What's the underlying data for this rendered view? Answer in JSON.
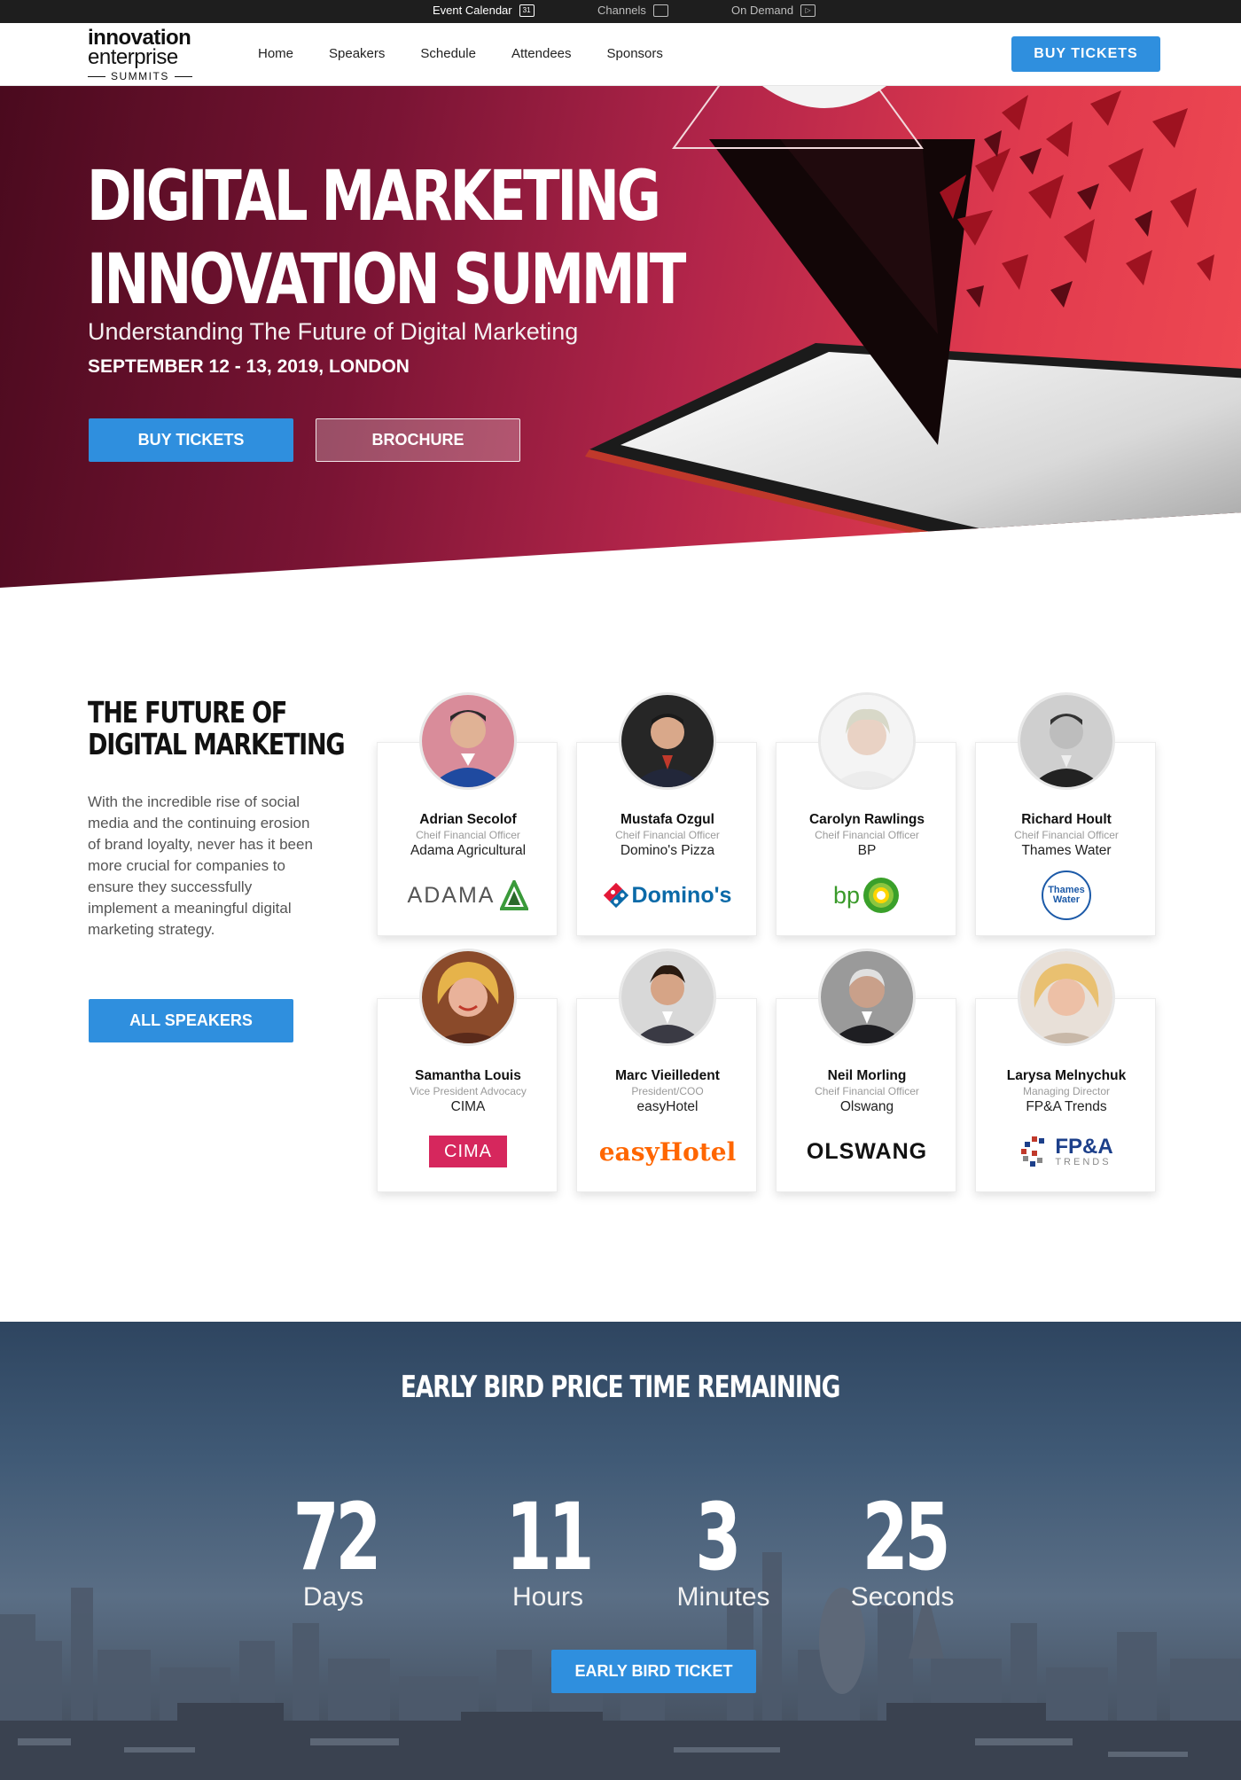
{
  "topbar": {
    "items": [
      {
        "label": "Event Calendar",
        "icon": "calendar-icon",
        "icon_text": "31"
      },
      {
        "label": "Channels",
        "icon": "monitor-icon"
      },
      {
        "label": "On Demand",
        "icon": "play-icon"
      }
    ]
  },
  "logo": {
    "line1": "innovation",
    "line2": "enterprise",
    "line3": "SUMMITS"
  },
  "nav": {
    "items": [
      "Home",
      "Speakers",
      "Schedule",
      "Attendees",
      "Sponsors"
    ],
    "buy_label": "BUY  TICKETS"
  },
  "hero": {
    "title_line1": "DIGITAL MARKETING",
    "title_line2": "INNOVATION SUMMIT",
    "subtitle": "Understanding The Future of Digital Marketing",
    "date": "SEPTEMBER 12 - 13, 2019, LONDON",
    "buy_label": "BUY TICKETS",
    "brochure_label": "BROCHURE"
  },
  "speakers_section": {
    "title_line1": "THE FUTURE OF",
    "title_line2": "DIGITAL MARKETING",
    "description": "With the incredible rise of social media and the continuing erosion of brand loyalty, never has it been more crucial for companies to ensure they successfully implement a meaningful digital marketing strategy.",
    "all_label": "ALL SPEAKERS",
    "speakers": [
      {
        "name": "Adrian Secolof",
        "role": "Cheif Financial Officer",
        "company": "Adama Agricultural",
        "logo_text": "ADAMA"
      },
      {
        "name": "Mustafa Ozgul",
        "role": "Cheif Financial Officer",
        "company": "Domino's Pizza",
        "logo_text": "Domino's"
      },
      {
        "name": "Carolyn Rawlings",
        "role": "Cheif Financial Officer",
        "company": "BP",
        "logo_text": "bp"
      },
      {
        "name": "Richard Hoult",
        "role": "Cheif Financial Officer",
        "company": "Thames Water",
        "logo_text": "Thames Water"
      },
      {
        "name": "Samantha Louis",
        "role": "Vice President Advocacy",
        "company": "CIMA",
        "logo_text": "CIMA"
      },
      {
        "name": "Marc Vieilledent",
        "role": "President/COO",
        "company": "easyHotel",
        "logo_text": "easyHotel"
      },
      {
        "name": "Neil Morling",
        "role": "Cheif Financial Officer",
        "company": "Olswang",
        "logo_text": "OLSWANG"
      },
      {
        "name": "Larysa Melnychuk",
        "role": "Managing Director",
        "company": "FP&A Trends",
        "logo_text": "FP&A",
        "logo_sub": "TRENDS"
      }
    ]
  },
  "countdown": {
    "title": "EARLY BIRD PRICE TIME REMAINING",
    "units": [
      {
        "value": "72",
        "label": "Days"
      },
      {
        "value": "11",
        "label": "Hours"
      },
      {
        "value": "3",
        "label": "Minutes"
      },
      {
        "value": "25",
        "label": "Seconds"
      }
    ],
    "button_label": "EARLY BIRD TICKET"
  },
  "colors": {
    "accent": "#2f8fde",
    "hero_dark": "#4a0a1e",
    "hero_red": "#f04a52"
  }
}
